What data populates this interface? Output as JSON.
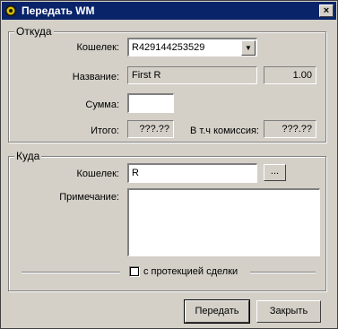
{
  "window": {
    "title": "Передать WM",
    "close_glyph": "×"
  },
  "from_group": {
    "legend": "Откуда",
    "purse_label": "Кошелек:",
    "purse_value": "R429144253529",
    "name_label": "Название:",
    "name_value": "First R",
    "balance_value": "1.00",
    "amount_label": "Сумма:",
    "amount_value": "",
    "total_label": "Итого:",
    "total_value": "???.??",
    "commission_label": "В т.ч комиссия:",
    "commission_value": "???.??"
  },
  "to_group": {
    "legend": "Куда",
    "purse_label": "Кошелек:",
    "purse_value": "R",
    "browse_label": "...",
    "note_label": "Примечание:",
    "note_value": "",
    "protection_label": "с протекцией сделки",
    "protection_checked": false
  },
  "buttons": {
    "send": "Передать",
    "close": "Закрыть"
  },
  "icons": {
    "logo": "webmoney-logo-icon",
    "close": "close-icon",
    "dropdown": "chevron-down-icon"
  },
  "colors": {
    "titlebar": "#0a246a",
    "face": "#d4d0c8"
  }
}
